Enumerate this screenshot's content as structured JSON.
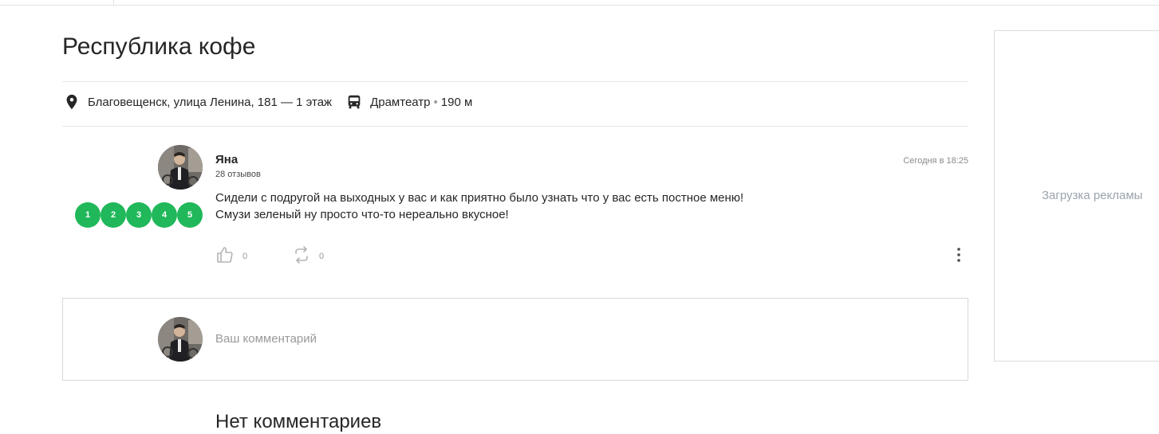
{
  "place": {
    "title": "Республика кофе",
    "address": "Благовещенск, улица Ленина, 181 — 1 этаж",
    "transit_stop": "Драмтеатр",
    "transit_separator": "•",
    "transit_distance": "190 м"
  },
  "review": {
    "author": "Яна",
    "reviews_count": "28 отзывов",
    "date": "Сегодня в 18:25",
    "rating_options": [
      "1",
      "2",
      "3",
      "4",
      "5"
    ],
    "text_line1": "Сидели с подругой на выходных у вас и как приятно было узнать что у вас есть постное меню!",
    "text_line2": "Смузи зеленый ну просто что-то нереально вкусное!",
    "likes": "0",
    "reposts": "0"
  },
  "comment_form": {
    "placeholder": "Ваш комментарий"
  },
  "comments": {
    "empty_heading": "Нет комментариев"
  },
  "ad": {
    "loading_text": "Загрузка рекламы"
  },
  "colors": {
    "rating_green": "#20b85a",
    "text": "#262626",
    "muted": "#9a9a9a"
  },
  "icons": [
    "map-pin-icon",
    "bus-icon",
    "thumbs-up-icon",
    "repost-icon",
    "more-vertical-icon"
  ]
}
